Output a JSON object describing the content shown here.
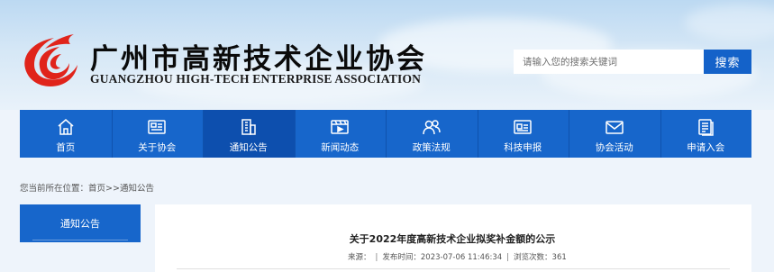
{
  "header": {
    "site_title": "广州市高新技术企业协会",
    "site_subtitle": "GUANGZHOU HIGH-TECH ENTERPRISE ASSOCIATION",
    "logo_icon": "flame-logo-icon",
    "brand_color": "#1766cb",
    "logo_color": "#e0241b"
  },
  "search": {
    "placeholder": "请输入您的搜索关键词",
    "value": "",
    "button_label": "搜索"
  },
  "nav": {
    "items": [
      {
        "label": "首页",
        "icon": "home-icon"
      },
      {
        "label": "关于协会",
        "icon": "newspaper-icon"
      },
      {
        "label": "通知公告",
        "icon": "building-icon",
        "active": true
      },
      {
        "label": "新闻动态",
        "icon": "video-icon"
      },
      {
        "label": "政策法规",
        "icon": "people-icon"
      },
      {
        "label": "科技申报",
        "icon": "id-card-icon"
      },
      {
        "label": "协会活动",
        "icon": "mail-icon"
      },
      {
        "label": "申请入会",
        "icon": "document-icon"
      }
    ]
  },
  "breadcrumb": {
    "prefix": "您当前所在位置：",
    "home": "首页",
    "separator": ">>",
    "current": "通知公告"
  },
  "sidebar": {
    "heading": "通知公告"
  },
  "article": {
    "title": "关于2022年度高新技术企业拟奖补金额的公示",
    "source_label": "来源：",
    "separator": "|",
    "published": "发布时间：2023-07-06 11:46:34",
    "views": "浏览次数：361"
  }
}
